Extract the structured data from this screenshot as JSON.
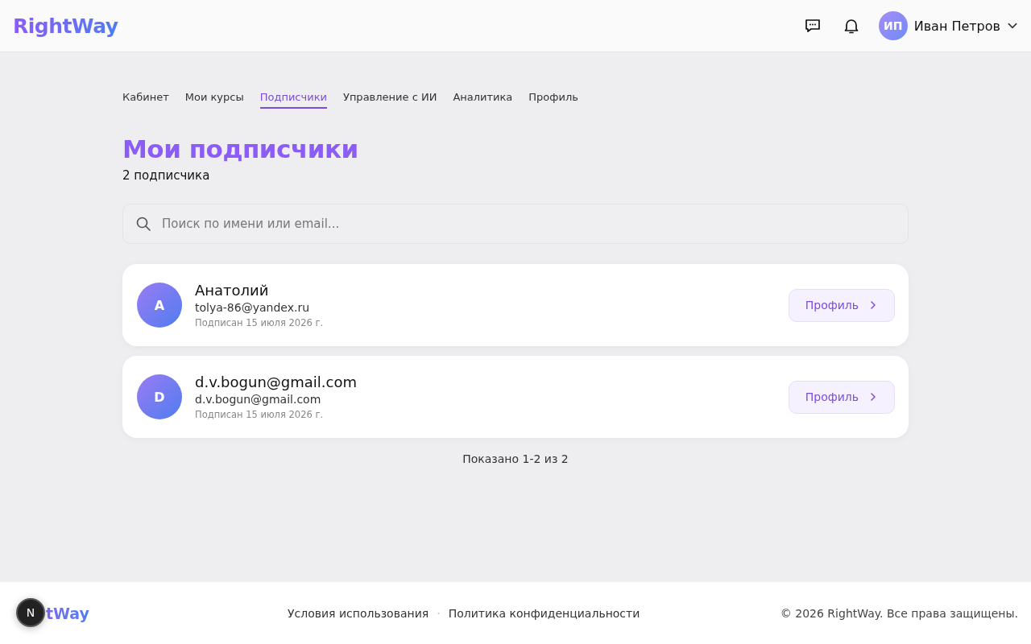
{
  "header": {
    "logo": "RightWay",
    "user": {
      "initials": "ИП",
      "name": "Иван Петров"
    }
  },
  "tabs": [
    {
      "label": "Кабинет",
      "selected": false
    },
    {
      "label": "Мои курсы",
      "selected": false
    },
    {
      "label": "Подписчики",
      "selected": true
    },
    {
      "label": "Управление с ИИ",
      "selected": false
    },
    {
      "label": "Аналитика",
      "selected": false
    },
    {
      "label": "Профиль",
      "selected": false
    }
  ],
  "page": {
    "title": "Мои подписчики",
    "count": "2 подписчика"
  },
  "search": {
    "placeholder": "Поиск по имени или email..."
  },
  "subscribers": [
    {
      "initial": "А",
      "name": "Анатолий",
      "email": "tolya-86@yandex.ru",
      "subscribed": "Подписан 15 июля 2026 г.",
      "button": "Профиль"
    },
    {
      "initial": "D",
      "name": "d.v.bogun@gmail.com",
      "email": "d.v.bogun@gmail.com",
      "subscribed": "Подписан 15 июля 2026 г.",
      "button": "Профиль"
    }
  ],
  "pagination": "Показано 1-2 из 2",
  "footer": {
    "logo": "tWay",
    "links": [
      "Условия использования",
      "Политика конфиденциальности"
    ],
    "separator": "·",
    "copyright": "© 2026 RightWay. Все права защищены.",
    "dev_badge": "N"
  }
}
